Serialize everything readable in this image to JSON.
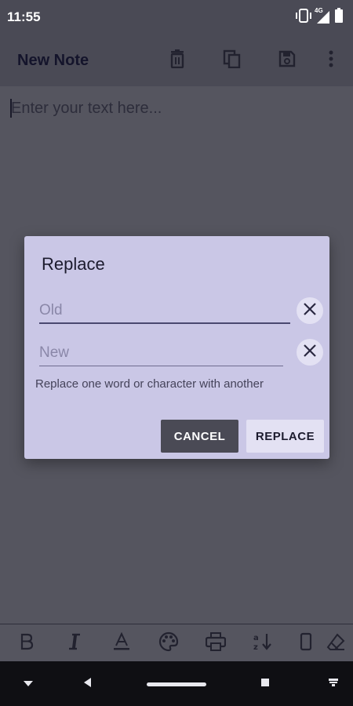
{
  "status_bar": {
    "time": "11:55",
    "icons": [
      "vibrate-icon",
      "4g-signal-icon",
      "battery-icon"
    ],
    "network_label": "4G"
  },
  "app_bar": {
    "title": "New Note",
    "actions": [
      "delete-icon",
      "copy-icon",
      "save-icon",
      "more-options-icon"
    ]
  },
  "editor": {
    "placeholder": "Enter your text here..."
  },
  "replace_dialog": {
    "title": "Replace",
    "old_placeholder": "Old",
    "new_placeholder": "New",
    "hint": "Replace one word or character with another",
    "cancel_label": "CANCEL",
    "replace_label": "REPLACE"
  },
  "format_bar": {
    "tools": [
      "bold-icon",
      "italic-icon",
      "text-color-icon",
      "palette-icon",
      "print-icon",
      "sort-icon",
      "device-icon",
      "eraser-icon"
    ]
  },
  "nav_bar": {
    "buttons": [
      "hide-keyboard-icon",
      "back-icon",
      "home-pill",
      "recents-icon",
      "keyboard-switch-icon"
    ]
  },
  "colors": {
    "scrim": "#55555f",
    "dialog_bg": "#cac7e6",
    "cancel_bg": "#4a4a55",
    "replace_bg": "#e3e1f3",
    "nav_bg": "#0f0f13"
  }
}
